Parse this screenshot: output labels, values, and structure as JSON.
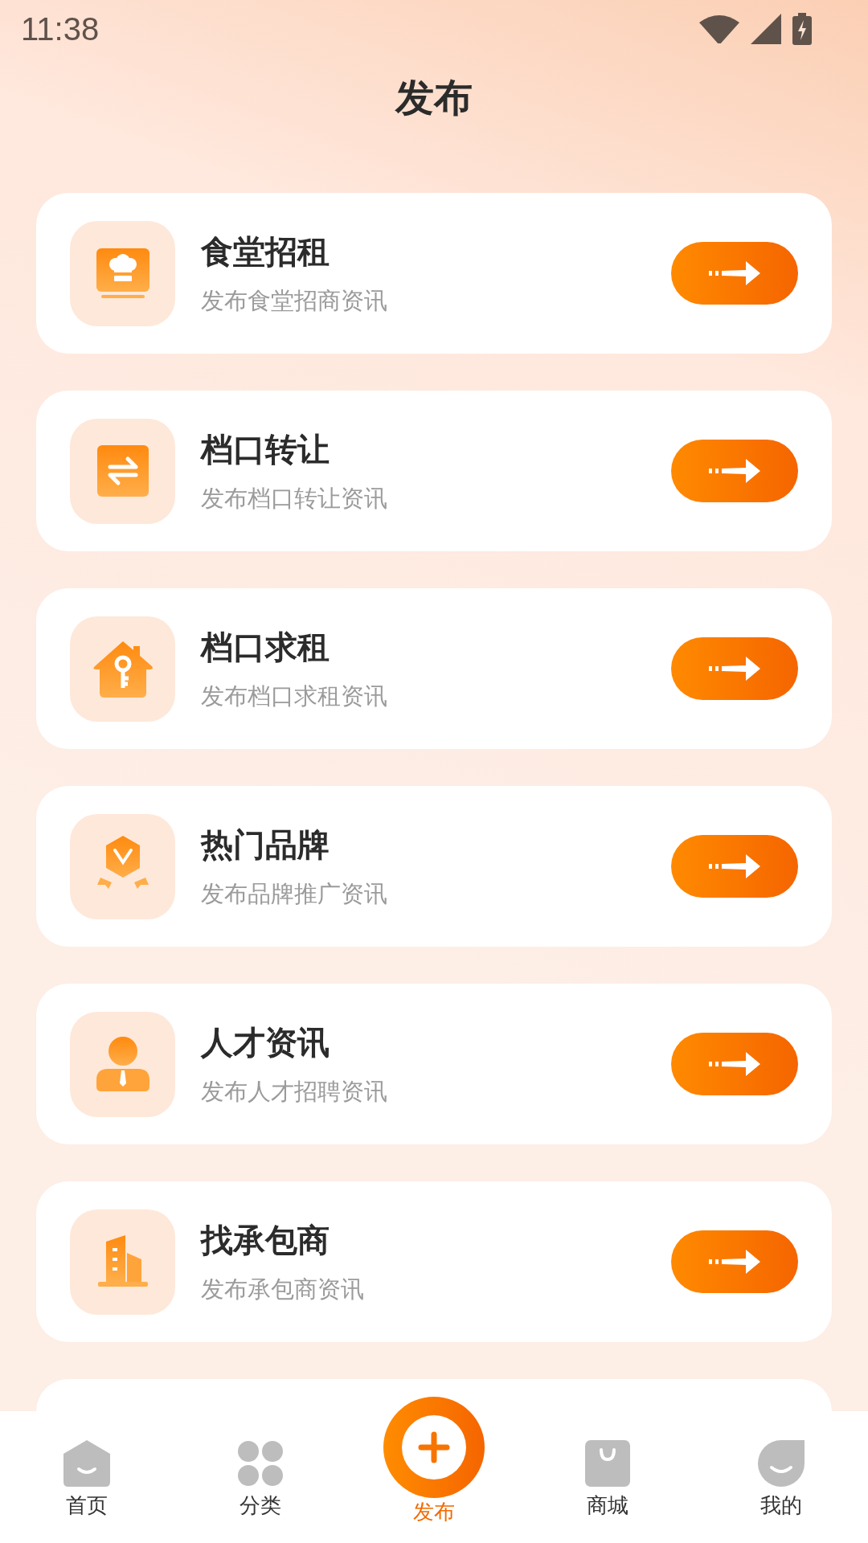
{
  "status_bar": {
    "time": "11:38"
  },
  "header": {
    "title": "发布"
  },
  "cards": [
    {
      "kind": "chef",
      "title": "食堂招租",
      "subtitle": "发布食堂招商资讯"
    },
    {
      "kind": "swap",
      "title": "档口转让",
      "subtitle": "发布档口转让资讯"
    },
    {
      "kind": "house",
      "title": "档口求租",
      "subtitle": "发布档口求租资讯"
    },
    {
      "kind": "badge",
      "title": "热门品牌",
      "subtitle": "发布品牌推广资讯"
    },
    {
      "kind": "person",
      "title": "人才资讯",
      "subtitle": "发布人才招聘资讯"
    },
    {
      "kind": "building",
      "title": "找承包商",
      "subtitle": "发布承包商资讯"
    }
  ],
  "tab_bar": [
    {
      "kind": "home",
      "label": "首页",
      "selected": false
    },
    {
      "kind": "grid",
      "label": "分类",
      "selected": false
    },
    {
      "kind": "publish",
      "label": "发布",
      "selected": true
    },
    {
      "kind": "shop",
      "label": "商城",
      "selected": false
    },
    {
      "kind": "me",
      "label": "我的",
      "selected": false
    }
  ]
}
